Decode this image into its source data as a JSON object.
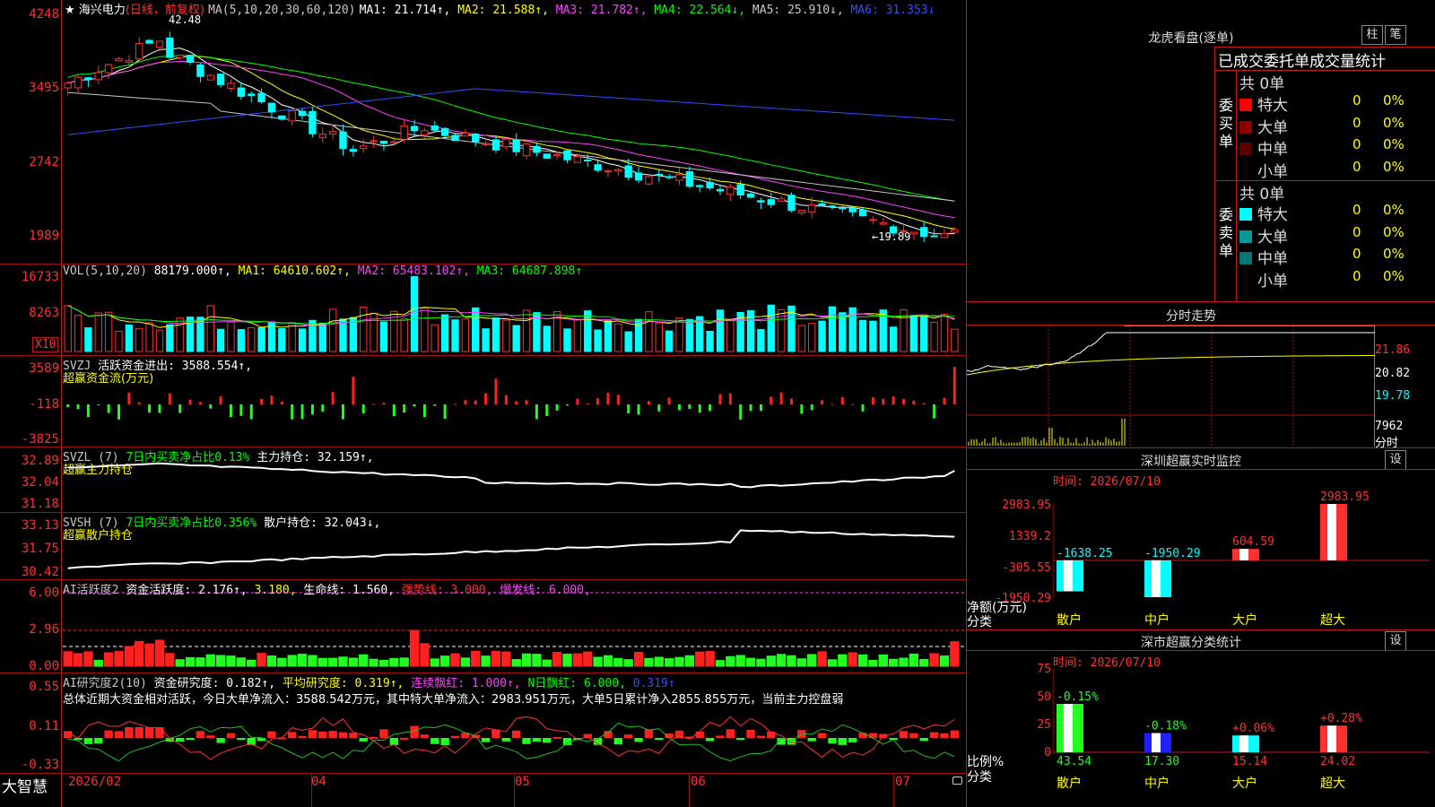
{
  "main": {
    "name": "海兴电力",
    "period_label": "(日线，前复权)",
    "ma_header": "MA(5,10,20,30,60,120)",
    "ma": [
      {
        "label": "MA1: 21.714↑",
        "color": "#ffffff"
      },
      {
        "label": "MA2: 21.588↑",
        "color": "#ffff00"
      },
      {
        "label": "MA3: 21.782↑",
        "color": "#ff40ff"
      },
      {
        "label": "MA4: 22.564↓",
        "color": "#00ff00"
      },
      {
        "label": "MA5: 25.910↓",
        "color": "#c8c8c8"
      },
      {
        "label": "MA6: 31.353↓",
        "color": "#3050ff"
      }
    ],
    "y_ticks": [
      "4248",
      "3495",
      "2742",
      "1989"
    ],
    "high_label": "42.48",
    "low_label": "←19.89"
  },
  "vol": {
    "title": "VOL(5,10,20)",
    "value": "88179.000↑,",
    "ma1": "MA1: 64610.602↑,",
    "ma2": "MA2: 65483.102↑,",
    "ma3": "MA3: 64687.898↑",
    "y_ticks": [
      "16733",
      "8263"
    ],
    "unit": "X10"
  },
  "svzj": {
    "title": "SVZJ",
    "line": "活跃资金进出: 3588.554↑,",
    "sub": "超赢资金流(万元)",
    "y_ticks": [
      "3589",
      "-118",
      "-3825"
    ]
  },
  "svzl": {
    "title": "SVZL (7)",
    "line1": "7日内买卖净占比0.13%",
    "line2": "主力持仓: 32.159↑,",
    "sub": "超赢主力持仓",
    "y_ticks": [
      "32.89",
      "32.04",
      "31.18"
    ]
  },
  "svsh": {
    "title": "SVSH (7)",
    "line1": "7日内买卖净占比0.356%",
    "line2": "散户持仓: 32.043↓,",
    "sub": "超赢散户持仓",
    "y_ticks": [
      "33.13",
      "31.75",
      "30.42"
    ]
  },
  "ai_active": {
    "title": "AI活跃度2",
    "l1": "资金活跃度: 2.176↑,",
    "l2": "3.180,",
    "l3": "生命线: 1.560,",
    "l4": "强势线: 3.000,",
    "l5": "爆发线: 6.000,",
    "y_ticks": [
      "6.00",
      "2.96",
      "0.00"
    ]
  },
  "ai_research": {
    "title": "AI研究度2(10)",
    "l1": "资金研究度: 0.182↑,",
    "l2": "平均研究度: 0.319↑,",
    "l3": "连续飘红: 1.000↑,",
    "l4": "N日飘红: 6.000,",
    "l5": "0.319↑",
    "summary": "总体近期大资金相对活跃，今日大单净流入：3588.542万元，其中特大单净流入：2983.951万元，大单5日累计净入2855.855万元，当前主力控盘弱",
    "y_ticks": [
      "0.55",
      "0.11",
      "-0.33"
    ]
  },
  "x_axis": {
    "brand": "大智慧",
    "labels": [
      "2026/02",
      "04",
      "05",
      "06",
      "07"
    ]
  },
  "longhu": {
    "title": "龙虎看盘(逐单)",
    "btn1": "柱",
    "btn2": "笔",
    "tabs": "已成交委托单成交量统计",
    "buy_label": "委买单",
    "sell_label": "委卖单",
    "buy_total": "共 0单",
    "sell_total": "共 0单",
    "buy_rows": [
      {
        "name": "特大",
        "count": "0",
        "pct": "0%",
        "color": "#ff0000"
      },
      {
        "name": "大单",
        "count": "0",
        "pct": "0%",
        "color": "#8b0000"
      },
      {
        "name": "中单",
        "count": "0",
        "pct": "0%",
        "color": "#5a0000"
      },
      {
        "name": "小单",
        "count": "0",
        "pct": "0%",
        "color": "#000000"
      }
    ],
    "sell_rows": [
      {
        "name": "特大",
        "count": "0",
        "pct": "0%",
        "color": "#00ffff"
      },
      {
        "name": "大单",
        "count": "0",
        "pct": "0%",
        "color": "#009999"
      },
      {
        "name": "中单",
        "count": "0",
        "pct": "0%",
        "color": "#007777"
      },
      {
        "name": "小单",
        "count": "0",
        "pct": "0%",
        "color": "#000000"
      }
    ]
  },
  "intraday": {
    "title": "分时走势",
    "p1": "21.86",
    "p2": "20.82",
    "p3": "19.78",
    "vol": "7962",
    "unit": "分时"
  },
  "sz_monitor": {
    "title": "深圳超赢实时监控",
    "set": "设",
    "time": "时间: 2026/07/10",
    "y_ticks": [
      "2983.95",
      "1339.2",
      "-305.55",
      "-1950.29"
    ],
    "ylabel": "净额(万元)",
    "xlabel": "分类",
    "categories": [
      "散户",
      "中户",
      "大户",
      "超大"
    ],
    "values_label": [
      "-1638.25",
      "-1950.29",
      "604.59",
      "2983.95"
    ]
  },
  "sz_class": {
    "title": "深市超赢分类统计",
    "set": "设",
    "time": "时间: 2026/07/10",
    "y_ticks": [
      "75",
      "50",
      "25",
      "0"
    ],
    "ylabel": "比例%",
    "xlabel": "分类",
    "categories": [
      "散户",
      "中户",
      "大户",
      "超大"
    ],
    "pct_labels": [
      "-0.15%",
      "-0.18%",
      "+0.06%",
      "+0.28%"
    ],
    "bottom_values": [
      "43.54",
      "17.30",
      "15.14",
      "24.02"
    ]
  },
  "chart_data": [
    {
      "type": "bar",
      "title": "深圳超赢实时监控",
      "ylabel": "净额(万元)",
      "xlabel": "分类",
      "categories": [
        "散户",
        "中户",
        "大户",
        "超大"
      ],
      "values": [
        -1638.25,
        -1950.29,
        604.59,
        2983.95
      ],
      "ylim": [
        -1950.29,
        2983.95
      ]
    },
    {
      "type": "bar",
      "title": "深市超赢分类统计",
      "ylabel": "比例%",
      "xlabel": "分类",
      "categories": [
        "散户",
        "中户",
        "大户",
        "超大"
      ],
      "values": [
        43.54,
        17.3,
        15.14,
        24.02
      ],
      "changes": [
        "-0.15%",
        "-0.18%",
        "+0.06%",
        "+0.28%"
      ],
      "ylim": [
        0,
        75
      ]
    }
  ]
}
